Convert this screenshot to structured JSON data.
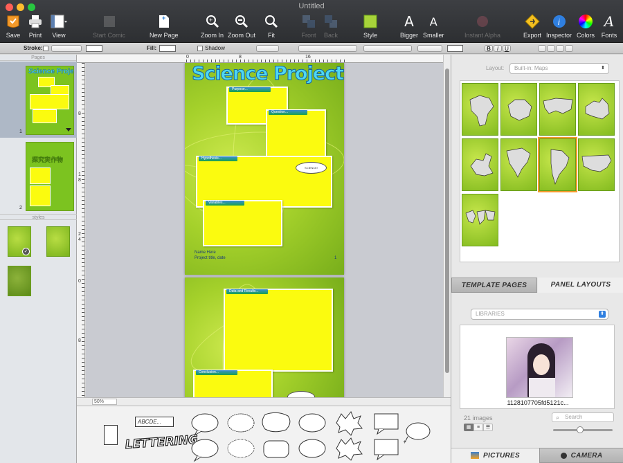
{
  "window": {
    "title": "Untitled"
  },
  "toolbar": {
    "save": "Save",
    "print": "Print",
    "view": "View",
    "start_comic": "Start Comic",
    "new_page": "New Page",
    "zoom_in": "Zoom In",
    "zoom_out": "Zoom Out",
    "fit": "Fit",
    "front": "Front",
    "back": "Back",
    "style": "Style",
    "bigger": "Bigger",
    "smaller": "Smaller",
    "instant_alpha": "Instant Alpha",
    "export": "Export",
    "inspector": "Inspector",
    "colors": "Colors",
    "fonts": "Fonts"
  },
  "formatbar": {
    "stroke_label": "Stroke:",
    "fill_label": "Fill:",
    "shadow_label": "Shadow",
    "bold": "B",
    "italic": "I",
    "underline": "U"
  },
  "left_panel": {
    "pages_header": "Pages",
    "styles_header": "styles",
    "pages": [
      {
        "number": "1",
        "title": "Science Project"
      },
      {
        "number": "2",
        "title": "探究実作物"
      }
    ]
  },
  "ruler": {
    "top": [
      "0",
      "8",
      "16"
    ],
    "left": [
      "8",
      "1",
      "8",
      "2",
      "4",
      "0",
      "8"
    ]
  },
  "zoom": {
    "level": "50%"
  },
  "page1": {
    "title": "Science Project",
    "panels": [
      "Purpose...",
      "Question...",
      "Hypothesis...",
      "Variables..."
    ],
    "bubble": "SCIENCE!",
    "caption_name": "Name Here",
    "caption_project": "Project title, date",
    "page_number": "1"
  },
  "page2": {
    "panels": [
      "Data and Results...",
      "Conclusion..."
    ]
  },
  "palette": {
    "caption_text": "ABCDE...",
    "lettering": "LETTERING"
  },
  "right_panel": {
    "layout_label": "Layout:",
    "layout_value": "Built-in: Maps",
    "maps": [
      "africa-map",
      "antarctica-map",
      "asia-map",
      "australia-map",
      "europe-map",
      "north-america-map",
      "south-america-map",
      "usa-map",
      "world-map"
    ],
    "selected_map": "south-america-map",
    "tabs": {
      "template_pages": "TEMPLATE PAGES",
      "panel_layouts": "PANEL LAYOUTS"
    },
    "library_select": "LIBRARIES",
    "image_caption": "1128107705fd5121c...",
    "image_count": "21 images",
    "search_placeholder": "Search",
    "zoom_slider": 0.45,
    "bottom_tabs": {
      "pictures": "PICTURES",
      "camera": "CAMERA"
    }
  },
  "colors": {
    "page_green": "#a5d12b",
    "panel_yellow": "#fbfb0f",
    "title_cyan": "#4fd8f2",
    "selection_orange": "#f39a2b"
  }
}
